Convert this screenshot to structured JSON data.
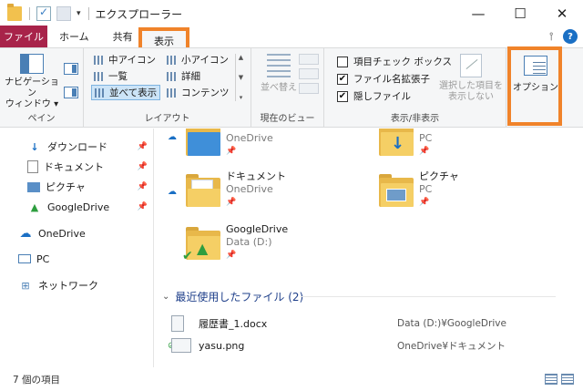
{
  "window": {
    "title": "エクスプローラー",
    "controls": {
      "minimize": "—",
      "maximize": "☐",
      "close": "✕"
    }
  },
  "tabs": {
    "file": "ファイル",
    "home": "ホーム",
    "share": "共有",
    "view": "表示"
  },
  "ribbon": {
    "panes": {
      "nav_pane_label": "ナビゲーション\nウィンドウ ▾",
      "group_label": "ペイン"
    },
    "layout": {
      "items": [
        "中アイコン",
        "小アイコン",
        "一覧",
        "詳細",
        "並べて表示",
        "コンテンツ"
      ],
      "selected": "並べて表示",
      "group_label": "レイアウト"
    },
    "current_view": {
      "sort_label": "並べ替え",
      "group_label": "現在のビュー"
    },
    "show_hide": {
      "item_checkboxes": {
        "label": "項目チェック ボックス",
        "checked": false
      },
      "file_extensions": {
        "label": "ファイル名拡張子",
        "checked": true
      },
      "hidden_items": {
        "label": "隠しファイル",
        "checked": true
      },
      "hide_selected_label": "選択した項目を\n表示しない",
      "group_label": "表示/非表示"
    },
    "options_label": "オプション"
  },
  "nav": {
    "items": [
      {
        "label": "ダウンロード",
        "pinned": true,
        "icon": "download-arrow-icon"
      },
      {
        "label": "ドキュメント",
        "pinned": true,
        "icon": "document-icon"
      },
      {
        "label": "ピクチャ",
        "pinned": true,
        "icon": "picture-icon"
      },
      {
        "label": "GoogleDrive",
        "pinned": true,
        "icon": "google-drive-icon"
      },
      {
        "label": "OneDrive",
        "pinned": false,
        "icon": "cloud-icon"
      },
      {
        "label": "PC",
        "pinned": false,
        "icon": "pc-icon"
      },
      {
        "label": "ネットワーク",
        "pinned": false,
        "icon": "network-icon"
      }
    ]
  },
  "content": {
    "folders": [
      {
        "name": "",
        "sub": "OneDrive",
        "icon": "desktop-folder-icon"
      },
      {
        "name": "",
        "sub": "PC",
        "icon": "download-folder-icon"
      },
      {
        "name": "ドキュメント",
        "sub": "OneDrive",
        "icon": "documents-folder-icon"
      },
      {
        "name": "ピクチャ",
        "sub": "PC",
        "icon": "pictures-folder-icon"
      },
      {
        "name": "GoogleDrive",
        "sub": "Data (D:)",
        "icon": "google-drive-folder-icon"
      }
    ],
    "recent_header": "最近使用したファイル (2)",
    "recent_files": [
      {
        "name": "履歴書_1.docx",
        "path": "Data (D:)¥GoogleDrive"
      },
      {
        "name": "yasu.png",
        "path": "OneDrive¥ドキュメント"
      }
    ]
  },
  "status": {
    "count": "7 個の項目"
  },
  "colors": {
    "file_tab": "#a8234a",
    "highlight": "#f0832a",
    "selected_layout": "#cce4f7"
  }
}
